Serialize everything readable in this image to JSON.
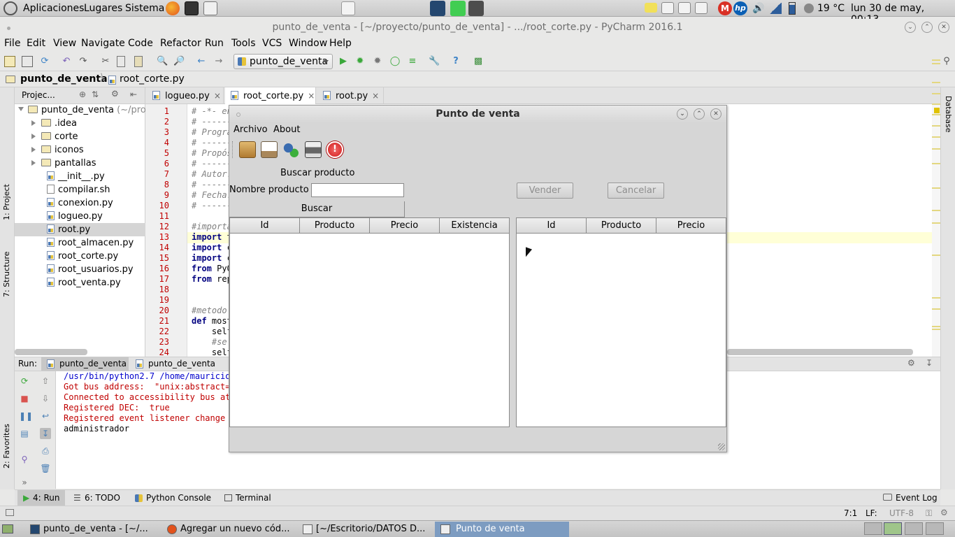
{
  "top_panel": {
    "apps": "Aplicaciones",
    "places": "Lugares",
    "system": "Sistema",
    "weather": "19 °C",
    "clock": "lun 30 de may, 00:13"
  },
  "window": {
    "title": "punto_de_venta - [~/proyecto/punto_de_venta] - .../root_corte.py - PyCharm 2016.1"
  },
  "menubar": [
    "File",
    "Edit",
    "View",
    "Navigate",
    "Code",
    "Refactor",
    "Run",
    "Tools",
    "VCS",
    "Window",
    "Help"
  ],
  "toolbar": {
    "run_config": "punto_de_venta"
  },
  "breadcrumb": {
    "project": "punto_de_venta",
    "file": "root_corte.py"
  },
  "side_tabs": {
    "project": "1: Project",
    "structure": "7: Structure",
    "favorites": "2: Favorites",
    "database": "Database"
  },
  "project_panel": {
    "header": "Projec...",
    "root": "punto_de_venta",
    "root_path": "(~/pro",
    "items": [
      {
        "name": ".idea",
        "type": "folder"
      },
      {
        "name": "corte",
        "type": "folder"
      },
      {
        "name": "iconos",
        "type": "folder"
      },
      {
        "name": "pantallas",
        "type": "folder"
      },
      {
        "name": "__init__.py",
        "type": "py"
      },
      {
        "name": "compilar.sh",
        "type": "sh"
      },
      {
        "name": "conexion.py",
        "type": "py"
      },
      {
        "name": "logueo.py",
        "type": "py"
      },
      {
        "name": "root.py",
        "type": "py",
        "selected": true
      },
      {
        "name": "root_almacen.py",
        "type": "py"
      },
      {
        "name": "root_corte.py",
        "type": "py"
      },
      {
        "name": "root_usuarios.py",
        "type": "py"
      },
      {
        "name": "root_venta.py",
        "type": "py"
      }
    ]
  },
  "editor": {
    "tabs": [
      {
        "label": "logueo.py",
        "close": "×"
      },
      {
        "label": "root_corte.py",
        "close": "×"
      },
      {
        "label": "root.py",
        "close": "×"
      }
    ],
    "line_numbers": [
      "1",
      "2",
      "3",
      "4",
      "5",
      "6",
      "7",
      "8",
      "9",
      "10",
      "11",
      "12",
      "13",
      "14",
      "15",
      "16",
      "17",
      "18",
      "19",
      "20",
      "21",
      "22",
      "23",
      "24"
    ],
    "lines": [
      {
        "t": "# -*- en",
        "c": "cmt"
      },
      {
        "t": "# ------",
        "c": "cmt"
      },
      {
        "t": "# Progra",
        "c": "cmt"
      },
      {
        "t": "# ------",
        "c": "cmt"
      },
      {
        "t": "# Propós",
        "c": "cmt"
      },
      {
        "t": "# ------",
        "c": "cmt"
      },
      {
        "t": "# Autor:",
        "c": "cmt"
      },
      {
        "t": "# ------",
        "c": "cmt"
      },
      {
        "t": "# Fecha:",
        "c": "cmt"
      },
      {
        "t": "# ------",
        "c": "cmt"
      },
      {
        "t": "",
        "c": ""
      },
      {
        "t": "#importa",
        "c": "cmt"
      },
      {
        "kw": "import",
        "t": " t",
        "c": ""
      },
      {
        "kw": "import",
        "t": " c",
        "c": ""
      },
      {
        "kw": "import",
        "t": " c",
        "c": ""
      },
      {
        "kw": "from",
        "t": " PyQ",
        "c": ""
      },
      {
        "kw": "from",
        "t": " rep",
        "c": ""
      },
      {
        "t": "",
        "c": ""
      },
      {
        "t": "",
        "c": ""
      },
      {
        "t": "#metodo",
        "c": "cmt"
      },
      {
        "kw": "def",
        "t": " most",
        "c": ""
      },
      {
        "t": "    self",
        "c": ""
      },
      {
        "t": "    #se",
        "c": "cmt"
      },
      {
        "t": "    self",
        "c": ""
      }
    ]
  },
  "run_panel": {
    "label": "Run:",
    "tabs": [
      "punto_de_venta",
      "punto_de_venta"
    ],
    "output": [
      {
        "t": "/usr/bin/python2.7 /home/mauricio/",
        "color": "#0000cc"
      },
      {
        "t": "Got bus address:  \"unix:abstract=/",
        "color": "#c00000"
      },
      {
        "t": "Connected to accessibility bus at:",
        "color": "#c00000"
      },
      {
        "t": "Registered DEC:  true",
        "color": "#c00000"
      },
      {
        "t": "Registered event listener change l",
        "color": "#c00000"
      },
      {
        "t": "administrador",
        "color": "#000000"
      }
    ]
  },
  "tool_windows": {
    "run": "4: Run",
    "todo": "6: TODO",
    "console": "Python Console",
    "terminal": "Terminal",
    "event_log": "Event Log"
  },
  "status": {
    "position": "7:1",
    "line_sep": "LF:",
    "encoding": "UTF-8"
  },
  "taskbar": [
    {
      "label": "punto_de_venta - [~/...",
      "active": false
    },
    {
      "label": "Agregar un nuevo cód...",
      "active": false
    },
    {
      "label": "[~/Escritorio/DATOS D...",
      "active": false
    },
    {
      "label": "Punto de venta",
      "active": true
    }
  ],
  "dialog": {
    "title": "Punto de venta",
    "menu": [
      "Archivo",
      "About"
    ],
    "search_heading": "Buscar producto",
    "product_name_label": "Nombre producto",
    "product_name_value": "",
    "search_button": "Buscar",
    "sell_button": "Vender",
    "cancel_button": "Cancelar",
    "left_table_headers": [
      "Id",
      "Producto",
      "Precio",
      "Existencia"
    ],
    "right_table_headers": [
      "Id",
      "Producto",
      "Precio"
    ]
  },
  "colors": {
    "accent_selection": "#7d9cc1",
    "current_line": "#ffffd7",
    "keyword": "#000080",
    "comment": "#808080"
  }
}
